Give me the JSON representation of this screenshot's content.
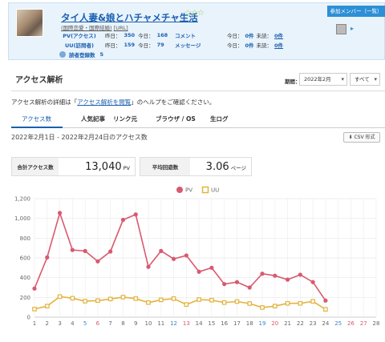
{
  "header": {
    "blog_title": "タイ人妻&娘とハチャメチャ生活",
    "stars": "☆☆☆",
    "categories": [
      "(国際恋愛・国際結婚)",
      "[URL]"
    ],
    "pv": {
      "label": "PV(アクセス)",
      "yesterday_label": "昨日：",
      "yesterday": "350",
      "today_label": "今日：",
      "today": "168"
    },
    "uu": {
      "label": "UU(訪問者)",
      "yesterday_label": "昨日：",
      "yesterday": "159",
      "today_label": "今日：",
      "today": "79"
    },
    "readers": {
      "label": "読者登録数",
      "value": "5"
    },
    "comment": {
      "label": "コメント",
      "today_label": "今日：",
      "today": "0件",
      "unread_label": "未読：",
      "unread": "0件"
    },
    "message": {
      "label": "メッセージ",
      "today_label": "今日：",
      "today": "0件",
      "unread_label": "未読：",
      "unread": "0件"
    },
    "member_button": "参加メンバー（一覧）",
    "member_arrow": "▸"
  },
  "section": {
    "title": "アクセス解析",
    "period_label": "期間：",
    "month_select": "2022年2月",
    "scope_select": "すべて",
    "help_pre": "アクセス解析の詳細は「",
    "help_link": "アクセス解析を閲覧",
    "help_post": "」のヘルプをご確認ください。"
  },
  "tabs": [
    "アクセス数",
    "人気記事",
    "リンク元",
    "ブラウザ / OS",
    "生ログ"
  ],
  "range_text": "2022年2月1日 - 2022年2月24日のアクセス数",
  "csv_button": "⬇ CSV 形式",
  "summary": {
    "total_label": "合計アクセス数",
    "total_value": "13,040",
    "total_unit": "PV",
    "avg_label": "平均回遊数",
    "avg_value": "3.06",
    "avg_unit": "ページ"
  },
  "colors": {
    "pv": "#d9596e",
    "uu": "#e3b33d",
    "saturday": "#3a86c8",
    "sunday": "#d9596e"
  },
  "chart_data": {
    "type": "line",
    "x": [
      1,
      2,
      3,
      4,
      5,
      6,
      7,
      8,
      9,
      10,
      11,
      12,
      13,
      14,
      15,
      16,
      17,
      18,
      19,
      20,
      21,
      22,
      23,
      24,
      25,
      26,
      27,
      28
    ],
    "x_tick_colors": [
      "#666",
      "#666",
      "#666",
      "#666",
      "#3a86c8",
      "#d9596e",
      "#666",
      "#666",
      "#666",
      "#666",
      "#666",
      "#3a86c8",
      "#d9596e",
      "#666",
      "#666",
      "#666",
      "#666",
      "#666",
      "#3a86c8",
      "#d9596e",
      "#666",
      "#666",
      "#666",
      "#666",
      "#3a86c8",
      "#d9596e",
      "#d9596e",
      "#666"
    ],
    "yticks": [
      "0",
      "200",
      "400",
      "600",
      "800",
      "1,000",
      "1,200"
    ],
    "ylim": [
      0,
      1200
    ],
    "grid": true,
    "legend_position": "top",
    "series": [
      {
        "name": "PV",
        "color": "#d9596e",
        "values": [
          290,
          605,
          1055,
          680,
          670,
          565,
          665,
          985,
          1040,
          510,
          670,
          590,
          625,
          460,
          500,
          335,
          355,
          300,
          440,
          420,
          380,
          430,
          355,
          168
        ]
      },
      {
        "name": "UU",
        "color": "#e3b33d",
        "values": [
          82,
          112,
          208,
          192,
          162,
          168,
          184,
          203,
          188,
          148,
          175,
          188,
          128,
          178,
          172,
          148,
          158,
          138,
          98,
          112,
          140,
          140,
          160,
          79
        ]
      }
    ]
  }
}
